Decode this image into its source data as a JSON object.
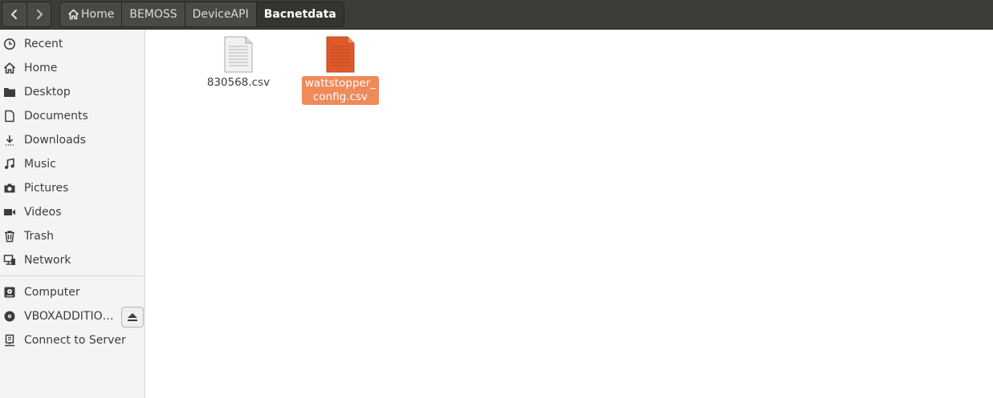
{
  "breadcrumb": {
    "items": [
      {
        "label": "Home"
      },
      {
        "label": "BEMOSS"
      },
      {
        "label": "DeviceAPI"
      },
      {
        "label": "Bacnetdata"
      }
    ]
  },
  "sidebar": {
    "items": [
      {
        "label": "Recent",
        "icon": "clock-icon"
      },
      {
        "label": "Home",
        "icon": "home-icon"
      },
      {
        "label": "Desktop",
        "icon": "folder-icon"
      },
      {
        "label": "Documents",
        "icon": "document-icon"
      },
      {
        "label": "Downloads",
        "icon": "download-icon"
      },
      {
        "label": "Music",
        "icon": "music-icon"
      },
      {
        "label": "Pictures",
        "icon": "camera-icon"
      },
      {
        "label": "Videos",
        "icon": "video-icon"
      },
      {
        "label": "Trash",
        "icon": "trash-icon"
      },
      {
        "label": "Network",
        "icon": "network-icon"
      }
    ],
    "devices": [
      {
        "label": "Computer",
        "icon": "drive-icon"
      },
      {
        "label": "VBOXADDITIO…",
        "icon": "disc-icon"
      },
      {
        "label": "Connect to Server",
        "icon": "server-icon"
      }
    ]
  },
  "files": [
    {
      "name": "830568.csv",
      "selected": false
    },
    {
      "name_line1": "wattstopper_",
      "name_line2": "config.csv",
      "selected": true
    }
  ],
  "colors": {
    "accent": "#ef8a5a",
    "file_selected_icon": "#e0592a",
    "headerbar": "#3d3c38"
  }
}
